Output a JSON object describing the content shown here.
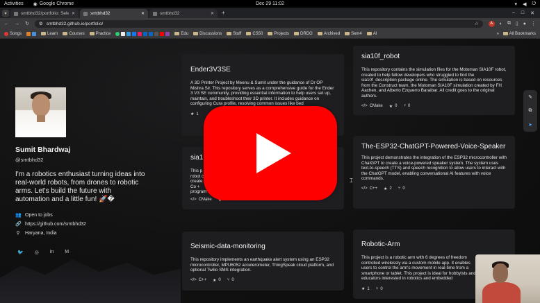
{
  "os": {
    "activities": "Activities",
    "app_name": "Google Chrome",
    "clock": "Dec 29  11:02"
  },
  "tabs": [
    {
      "title": "smtbhd32/portfolio: Sele",
      "active": false
    },
    {
      "title": "smtbhd32",
      "active": true
    },
    {
      "title": "smtbhd32",
      "active": false
    }
  ],
  "address": {
    "url": "smtbhd32.github.io/portfolio/"
  },
  "profile_initial": "A",
  "bookmarks": {
    "items": [
      "Songs",
      "Learn",
      "Courses",
      "Practice",
      "Edu",
      "Discussions",
      "Stuff",
      "CS50",
      "Projects",
      "DRDO",
      "Archived",
      "Sem4",
      "AI"
    ],
    "all_label": "All Bookmarks"
  },
  "profile": {
    "name": "Sumit Bhardwaj",
    "handle": "@smtbhd32",
    "bio": "I'm a robotics enthusiast turning ideas into real-world robots, from drones to robotic arms. Let's build the future with automation and a little fun! 🚀�",
    "status": "Open to jobs",
    "link": "https://github.com/smtbhd32",
    "location": "Haryana, India",
    "socials": [
      "twitter",
      "dribbble",
      "linkedin",
      "medium"
    ]
  },
  "cards": [
    {
      "title": "Ender3V3SE",
      "desc": "A 3D Printer Project by Meenu & Sumit under the guidance of Dr OP Mishra Sir. This repository serves as a comprehensive guide for the Ender 3 V3 SE community, providing essential information to help users set up, maintain, and troubleshoot their 3D printer. It includes guidance on configuring Cura profile, resolving common issues like bed",
      "stars": "1",
      "lang": "",
      "forks": ""
    },
    {
      "title": "sia10f_robot",
      "desc": "This repository contains the simulation files for the Motoman SIA10F robot, created to help fellow developers who struggled to find the sia10f_description package online. The simulation is based on resources from the Construct team, the Motoman SIA10F simulation created by FH Aachen, and Alberto Ezquerro Baraibar. All credit goes to the original authors.",
      "lang": "CMake",
      "stars": "0",
      "forks": "0"
    },
    {
      "title": "sia1",
      "desc": "This p robot c create The Co + program",
      "lang": "CMake",
      "stars": "1",
      "forks": "0"
    },
    {
      "title": "The-ESP32-ChatGPT-Powered-Voice-Speaker",
      "desc": "This project demonstrates the integration of the ESP32 microcontroller with ChatGPT to create a voice-powered speaker system. The system uses text-to-speech (TTS) and speech recognition to allow users to interact with the ChatGPT model, enabling conversational AI features with voice commands.",
      "lang": "C++",
      "stars": "2",
      "forks": "0"
    },
    {
      "title": "Seismic-data-monitoring",
      "desc": "This repository implements an earthquake alert system using an ESP32 microcontroller, MPU6052 accelerometer, ThingSpeak cloud platform, and optional Twilio SMS integration.",
      "lang": "C++",
      "stars": "0",
      "forks": "0"
    },
    {
      "title": "Robotic-Arm",
      "desc": "This project is a robotic arm with 6 degrees of freedom controlled wirelessly via a custom mobile app. It enables users to control the arm's movement in real-time from a smartphone or tablet. This project is ideal for hobbyists and educators interested in robotics and embedded",
      "stars": "1",
      "forks": "0"
    }
  ],
  "colors": {
    "youtube_red": "#ff0000",
    "card_bg": "#1e1e20",
    "page_bg": "#121212"
  }
}
